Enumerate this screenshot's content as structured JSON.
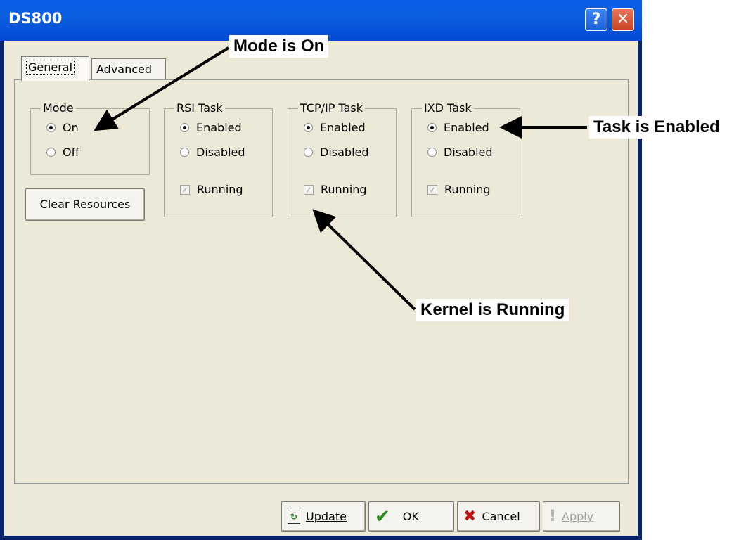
{
  "window": {
    "title": "DS800",
    "help_glyph": "?",
    "close_glyph": "✕"
  },
  "tabs": [
    {
      "label": "General",
      "selected": true
    },
    {
      "label": "Advanced",
      "selected": false
    }
  ],
  "groups": {
    "mode": {
      "title": "Mode",
      "options": [
        {
          "label": "On",
          "selected": true
        },
        {
          "label": "Off",
          "selected": false
        }
      ]
    },
    "rsi": {
      "title": "RSI Task",
      "options": [
        {
          "label": "Enabled",
          "selected": true
        },
        {
          "label": "Disabled",
          "selected": false
        }
      ],
      "running_label": "Running",
      "running_checked": true
    },
    "tcpip": {
      "title": "TCP/IP Task",
      "options": [
        {
          "label": "Enabled",
          "selected": true
        },
        {
          "label": "Disabled",
          "selected": false
        }
      ],
      "running_label": "Running",
      "running_checked": true
    },
    "ixd": {
      "title": "IXD Task",
      "options": [
        {
          "label": "Enabled",
          "selected": true
        },
        {
          "label": "Disabled",
          "selected": false
        }
      ],
      "running_label": "Running",
      "running_checked": true
    }
  },
  "buttons": {
    "clear_resources": "Clear Resources",
    "update": "Update",
    "ok": "OK",
    "cancel": "Cancel",
    "apply": "Apply"
  },
  "icons": {
    "update": "refresh-icon",
    "ok": "checkmark-icon",
    "cancel": "x-icon",
    "apply": "exclamation-icon"
  },
  "annotations": {
    "mode_is_on": "Mode is On",
    "task_is_enabled": "Task is Enabled",
    "kernel_is_running": "Kernel is Running"
  },
  "colors": {
    "title_bar": "#0a5fe8",
    "dialog_bg": "#ece9d8",
    "close_button": "#c8421f",
    "ok_check": "#2a8a1a",
    "cancel_x": "#c01010"
  }
}
